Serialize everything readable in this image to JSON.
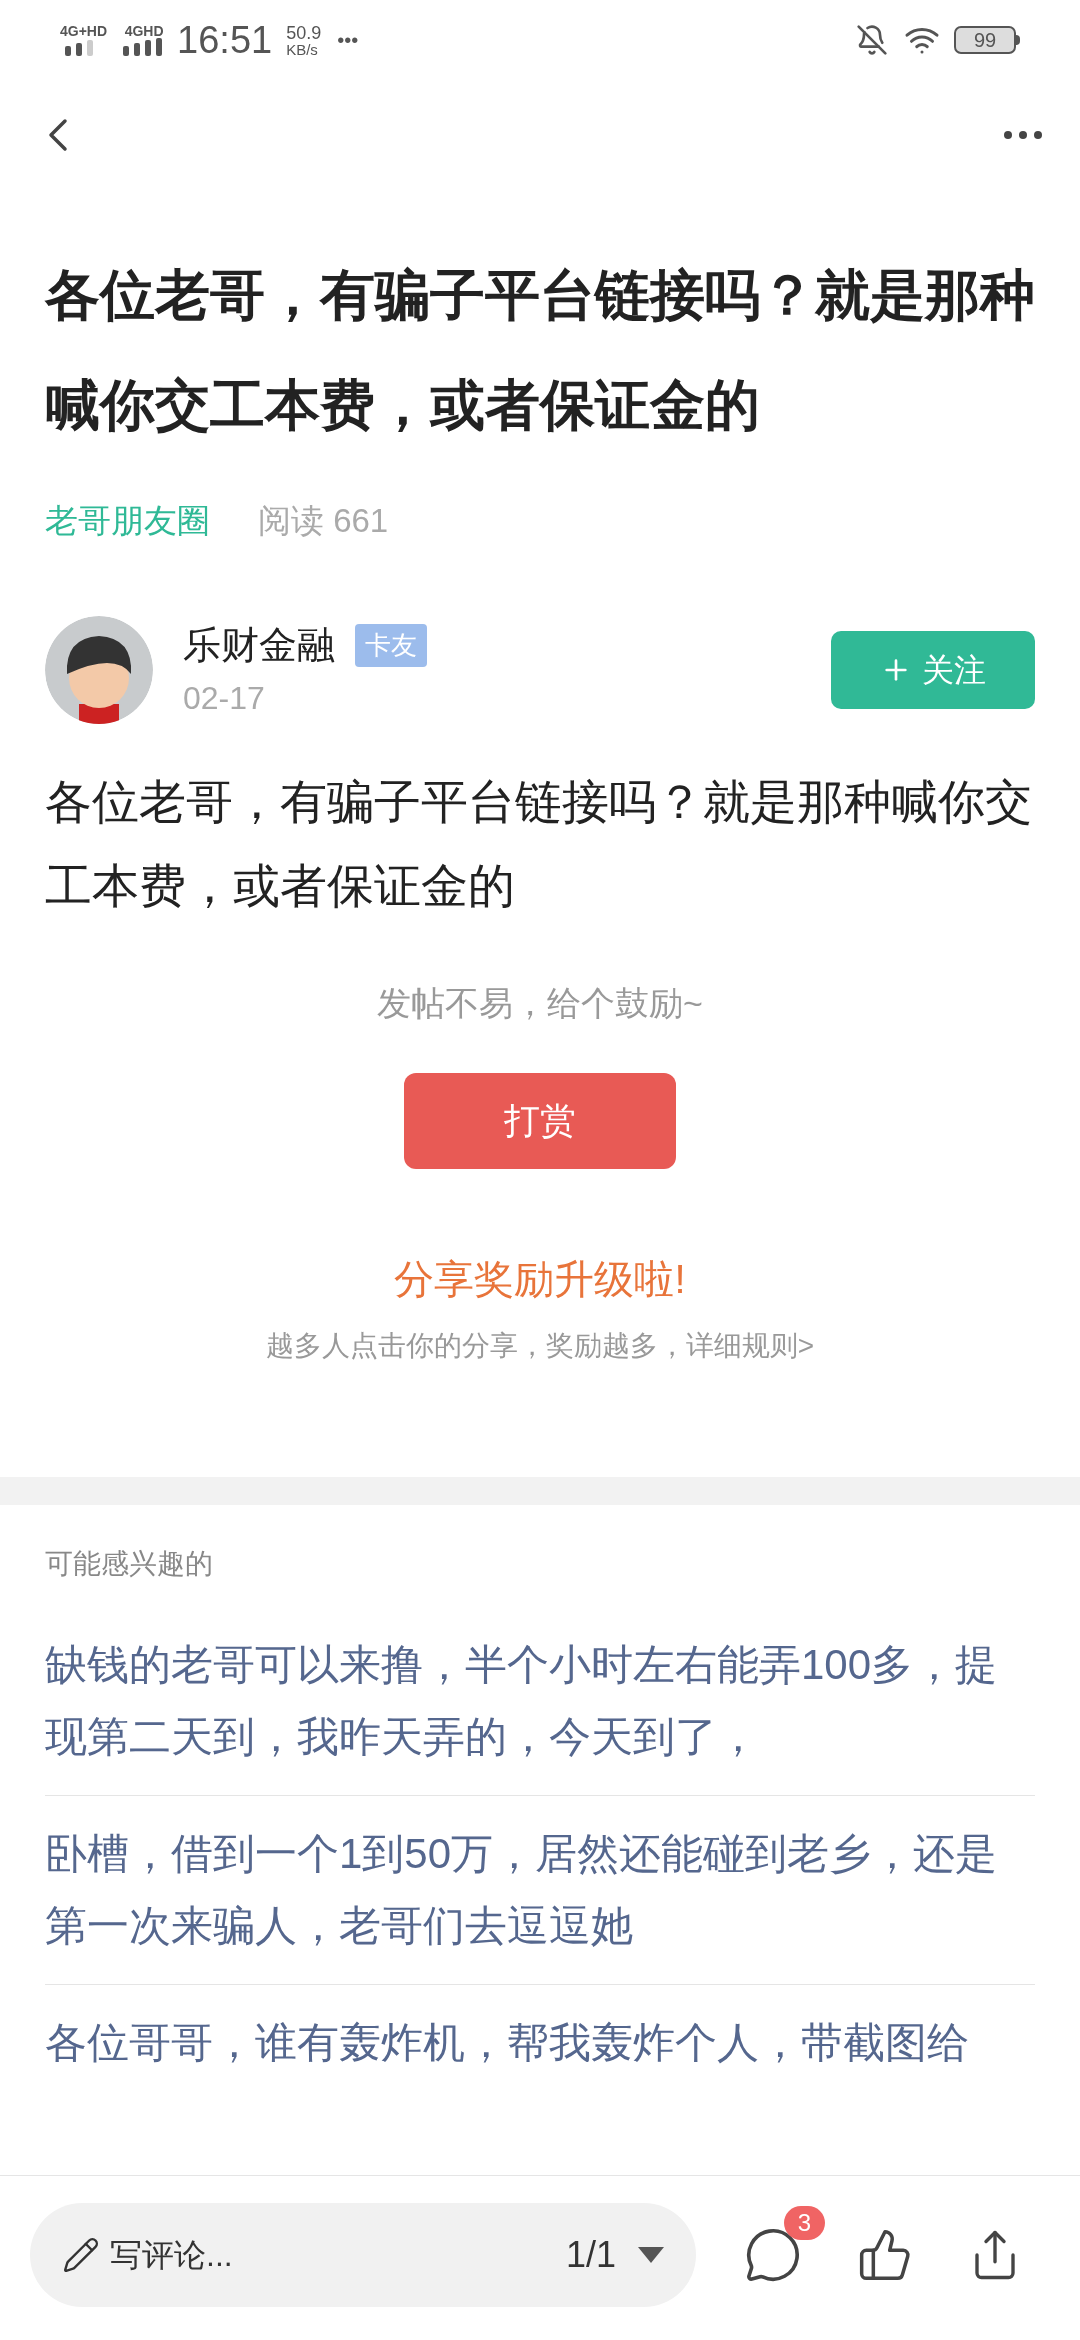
{
  "status_bar": {
    "network_1": "4G+HD",
    "network_2": "4GHD",
    "time": "16:51",
    "speed_value": "50.9",
    "speed_unit": "KB/s",
    "more": "•••",
    "battery": "99"
  },
  "title": "各位老哥，有骗子平台链接吗？就是那种喊你交工本费，或者保证金的",
  "circle": "老哥朋友圈",
  "reads": "阅读 661",
  "author": {
    "name": "乐财金融",
    "tag": "卡友",
    "date": "02-17",
    "follow_label": "关注",
    "following": false
  },
  "body": "各位老哥，有骗子平台链接吗？就是那种喊你交工本费，或者保证金的",
  "reward": {
    "hint": "发帖不易，给个鼓励~",
    "button": "打赏"
  },
  "share": {
    "headline": "分享奖励升级啦!",
    "subtitle": "越多人点击你的分享，奖励越多，详细规则>"
  },
  "related": {
    "heading": "可能感兴趣的",
    "items": [
      {
        "text": "缺钱的老哥可以来撸，半个小时左右能弄100多，提现第二天到，我昨天弄的，今天到了，"
      },
      {
        "text": "卧槽，借到一个1到50万，居然还能碰到老乡，还是第一次来骗人，老哥们去逗逗她"
      },
      {
        "text": "各位哥哥，谁有轰炸机，帮我轰炸个人，带截图给"
      }
    ]
  },
  "bottom_bar": {
    "comment_placeholder": "写评论...",
    "page": "1/1",
    "comment_count": "3"
  }
}
